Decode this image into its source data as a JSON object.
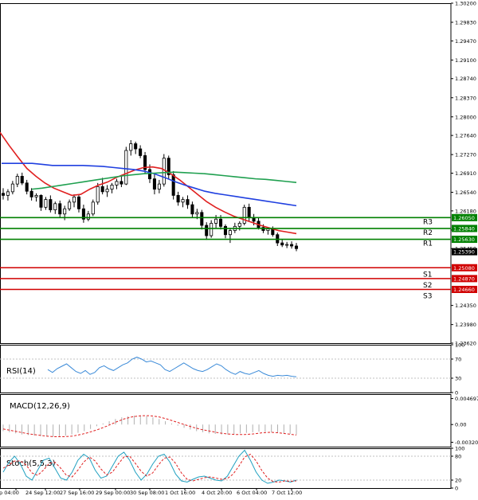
{
  "chart_data": {
    "type": "candlestick",
    "instrument_timeframe": "",
    "x_axis": {
      "tick_labels": [
        "ep 04:00",
        "24 Sep 12:00",
        "27 Sep 16:00",
        "29 Sep 00:00",
        "30 Sep 08:00",
        "1 Oct 16:00",
        "4 Oct 20:00",
        "6 Oct 04:00",
        "7 Oct 12:00"
      ]
    },
    "main_panel": {
      "y_ticks": [
        "1.30200",
        "1.29830",
        "1.29470",
        "1.29100",
        "1.28740",
        "1.28370",
        "1.28000",
        "1.27640",
        "1.27270",
        "1.26910",
        "1.26540",
        "1.26180",
        "1.25810",
        "1.25450",
        "1.24350",
        "1.23980",
        "1.23620"
      ],
      "ylim": [
        1.2362,
        1.302
      ],
      "current_price": "1.25390",
      "levels": [
        {
          "name": "R3",
          "value": 1.2605,
          "label": "1.26050",
          "color": "#008000"
        },
        {
          "name": "R2",
          "value": 1.2584,
          "label": "1.25840",
          "color": "#008000"
        },
        {
          "name": "R1",
          "value": 1.2563,
          "label": "1.25630",
          "color": "#008000"
        },
        {
          "name": "S1",
          "value": 1.2508,
          "label": "1.25080",
          "color": "#d00000"
        },
        {
          "name": "S2",
          "value": 1.2487,
          "label": "1.24870",
          "color": "#d00000"
        },
        {
          "name": "S3",
          "value": 1.2466,
          "label": "1.24660",
          "color": "#d00000"
        }
      ],
      "candles": [
        [
          1.2652,
          1.2662,
          1.264,
          1.2648
        ],
        [
          1.2648,
          1.266,
          1.2638,
          1.2655
        ],
        [
          1.2655,
          1.2676,
          1.265,
          1.267
        ],
        [
          1.267,
          1.269,
          1.2664,
          1.2685
        ],
        [
          1.2685,
          1.2692,
          1.2668,
          1.2672
        ],
        [
          1.2672,
          1.2678,
          1.265,
          1.2656
        ],
        [
          1.2656,
          1.2662,
          1.2638,
          1.2645
        ],
        [
          1.2645,
          1.2652,
          1.2636,
          1.2648
        ],
        [
          1.2648,
          1.265,
          1.2618,
          1.2625
        ],
        [
          1.2625,
          1.2645,
          1.262,
          1.264
        ],
        [
          1.264,
          1.2648,
          1.2615,
          1.262
        ],
        [
          1.262,
          1.2636,
          1.2612,
          1.2632
        ],
        [
          1.2632,
          1.2638,
          1.2605,
          1.2612
        ],
        [
          1.2612,
          1.2628,
          1.26,
          1.2622
        ],
        [
          1.2622,
          1.264,
          1.2618,
          1.2635
        ],
        [
          1.2635,
          1.265,
          1.2625,
          1.2645
        ],
        [
          1.2645,
          1.265,
          1.2615,
          1.2622
        ],
        [
          1.2622,
          1.263,
          1.2595,
          1.2602
        ],
        [
          1.2602,
          1.2618,
          1.2598,
          1.2612
        ],
        [
          1.2612,
          1.264,
          1.2608,
          1.2635
        ],
        [
          1.2635,
          1.2672,
          1.263,
          1.2665
        ],
        [
          1.2665,
          1.2682,
          1.265,
          1.2655
        ],
        [
          1.2655,
          1.2668,
          1.2645,
          1.266
        ],
        [
          1.266,
          1.2672,
          1.2652,
          1.2668
        ],
        [
          1.2668,
          1.268,
          1.266,
          1.2675
        ],
        [
          1.2675,
          1.2688,
          1.2664,
          1.267
        ],
        [
          1.267,
          1.2742,
          1.2668,
          1.2735
        ],
        [
          1.2735,
          1.2755,
          1.2725,
          1.2748
        ],
        [
          1.2748,
          1.2752,
          1.2728,
          1.2738
        ],
        [
          1.2738,
          1.2745,
          1.272,
          1.2725
        ],
        [
          1.2725,
          1.2732,
          1.269,
          1.2698
        ],
        [
          1.2698,
          1.2708,
          1.2672,
          1.268
        ],
        [
          1.268,
          1.269,
          1.265,
          1.266
        ],
        [
          1.266,
          1.2678,
          1.2652,
          1.267
        ],
        [
          1.267,
          1.2728,
          1.2665,
          1.272
        ],
        [
          1.272,
          1.2725,
          1.268,
          1.2688
        ],
        [
          1.2688,
          1.2695,
          1.264,
          1.2648
        ],
        [
          1.2648,
          1.2655,
          1.2628,
          1.2635
        ],
        [
          1.2635,
          1.2645,
          1.2625,
          1.264
        ],
        [
          1.264,
          1.2648,
          1.2622,
          1.263
        ],
        [
          1.263,
          1.2636,
          1.2605,
          1.2612
        ],
        [
          1.2612,
          1.2622,
          1.2602,
          1.2615
        ],
        [
          1.2615,
          1.262,
          1.2582,
          1.259
        ],
        [
          1.259,
          1.2596,
          1.2562,
          1.257
        ],
        [
          1.257,
          1.26,
          1.2566,
          1.2594
        ],
        [
          1.2594,
          1.261,
          1.2585,
          1.2602
        ],
        [
          1.2602,
          1.261,
          1.2582,
          1.2588
        ],
        [
          1.2588,
          1.2592,
          1.2565,
          1.2572
        ],
        [
          1.2572,
          1.2585,
          1.2556,
          1.258
        ],
        [
          1.258,
          1.2595,
          1.2575,
          1.2588
        ],
        [
          1.2588,
          1.2598,
          1.258,
          1.2594
        ],
        [
          1.2594,
          1.263,
          1.259,
          1.2625
        ],
        [
          1.2625,
          1.2632,
          1.2598,
          1.2605
        ],
        [
          1.2605,
          1.2612,
          1.259,
          1.2598
        ],
        [
          1.2598,
          1.2604,
          1.2582,
          1.2586
        ],
        [
          1.2586,
          1.2592,
          1.2575,
          1.258
        ],
        [
          1.258,
          1.2586,
          1.2572,
          1.2583
        ],
        [
          1.2583,
          1.2588,
          1.2568,
          1.2572
        ],
        [
          1.2572,
          1.2576,
          1.255,
          1.2556
        ],
        [
          1.2556,
          1.2562,
          1.2548,
          1.2552
        ],
        [
          1.2552,
          1.2558,
          1.2546,
          1.2553
        ],
        [
          1.2553,
          1.2559,
          1.2545,
          1.255
        ],
        [
          1.255,
          1.2556,
          1.254,
          1.2545
        ]
      ],
      "ma_series": [
        {
          "color": "#e02020",
          "values": [
            1.277,
            1.2745,
            1.2722,
            1.27,
            1.2685,
            1.2672,
            1.2662,
            1.2655,
            1.2648,
            1.265,
            1.266,
            1.2668,
            1.2674,
            1.2683,
            1.269,
            1.2697,
            1.2702,
            1.2703,
            1.27,
            1.269,
            1.2678,
            1.2664,
            1.265,
            1.2636,
            1.2625,
            1.2616,
            1.2608,
            1.2602,
            1.2596,
            1.259,
            1.2585,
            1.258,
            1.2577,
            1.2574
          ]
        },
        {
          "color": "#2040e0",
          "values": [
            1.271,
            1.271,
            1.271,
            1.271,
            1.2708,
            1.2706,
            1.2706,
            1.2706,
            1.2706,
            1.2705,
            1.2704,
            1.2702,
            1.27,
            1.2698,
            1.2695,
            1.269,
            1.2683,
            1.2675,
            1.2668,
            1.2662,
            1.2656,
            1.2652,
            1.2649,
            1.2646,
            1.2643,
            1.264,
            1.2637,
            1.2634,
            1.2631,
            1.2628
          ]
        },
        {
          "color": "#20a050",
          "values": [
            1.266,
            1.2662,
            1.2665,
            1.2668,
            1.2671,
            1.2674,
            1.2677,
            1.268,
            1.2683,
            1.2686,
            1.2688,
            1.269,
            1.2691,
            1.2692,
            1.2693,
            1.2692,
            1.2691,
            1.269,
            1.2688,
            1.2686,
            1.2684,
            1.2682,
            1.268,
            1.2679,
            1.2677,
            1.2675,
            1.2673
          ]
        }
      ]
    },
    "rsi_panel": {
      "label": "RSI(14)",
      "y_ticks": [
        "100",
        "70",
        "30",
        "0"
      ],
      "ylim": [
        0,
        100
      ],
      "values": [
        48,
        42,
        50,
        55,
        60,
        52,
        44,
        40,
        46,
        38,
        42,
        52,
        56,
        50,
        46,
        52,
        58,
        62,
        70,
        74,
        70,
        64,
        66,
        62,
        58,
        48,
        44,
        50,
        56,
        62,
        56,
        50,
        46,
        44,
        48,
        54,
        60,
        56,
        48,
        42,
        38,
        44,
        40,
        38,
        42,
        46,
        40,
        36,
        34,
        36,
        35,
        36,
        34,
        33
      ]
    },
    "macd_panel": {
      "label": "MACD(12,26,9)",
      "y_ticks": [
        "0.004697",
        "0.00",
        "-0.003206"
      ],
      "ylim": [
        -0.004,
        0.0055
      ],
      "histogram": [
        -0.0012,
        -0.0014,
        -0.0016,
        -0.0018,
        -0.0019,
        -0.002,
        -0.0021,
        -0.0022,
        -0.0022,
        -0.0021,
        -0.002,
        -0.0018,
        -0.0015,
        -0.0012,
        -0.0008,
        -0.0003,
        0.0002,
        0.0006,
        0.001,
        0.0013,
        0.0015,
        0.0016,
        0.0016,
        0.0015,
        0.0013,
        0.001,
        0.0006,
        0.0002,
        -0.0002,
        -0.0006,
        -0.0009,
        -0.0012,
        -0.0014,
        -0.0016,
        -0.0017,
        -0.0018,
        -0.0018,
        -0.0017,
        -0.0016,
        -0.0015,
        -0.0014,
        -0.0013,
        -0.0013,
        -0.0014,
        -0.0015,
        -0.0016,
        -0.0017,
        -0.0018
      ],
      "signal": [
        -0.0008,
        -0.0011,
        -0.0014,
        -0.0017,
        -0.0019,
        -0.0021,
        -0.0022,
        -0.0022,
        -0.0021,
        -0.0018,
        -0.0014,
        -0.0009,
        -0.0003,
        0.0004,
        0.001,
        0.0014,
        0.0016,
        0.0016,
        0.0014,
        0.001,
        0.0005,
        0.0,
        -0.0005,
        -0.0009,
        -0.0012,
        -0.0015,
        -0.0017,
        -0.0018,
        -0.0018,
        -0.0017,
        -0.0015,
        -0.0014,
        -0.0015,
        -0.0017,
        -0.0019
      ]
    },
    "stoch_panel": {
      "label": "Stoch(5,5,3)",
      "y_ticks": [
        "100",
        "80",
        "20",
        "0"
      ],
      "ylim": [
        0,
        100
      ],
      "k": [
        40,
        65,
        80,
        60,
        30,
        20,
        45,
        70,
        75,
        50,
        25,
        20,
        40,
        70,
        85,
        75,
        45,
        25,
        30,
        55,
        80,
        90,
        70,
        40,
        20,
        35,
        60,
        80,
        85,
        65,
        35,
        18,
        15,
        22,
        28,
        30,
        25,
        20,
        18,
        30,
        55,
        80,
        95,
        70,
        40,
        20,
        12,
        15,
        20,
        18,
        15,
        20
      ],
      "d": [
        50,
        58,
        68,
        68,
        58,
        38,
        32,
        45,
        62,
        65,
        50,
        32,
        28,
        45,
        65,
        78,
        68,
        48,
        33,
        40,
        60,
        78,
        80,
        62,
        42,
        30,
        38,
        58,
        75,
        78,
        62,
        38,
        22,
        18,
        22,
        26,
        28,
        25,
        22,
        24,
        35,
        55,
        78,
        85,
        68,
        44,
        25,
        16,
        15,
        18,
        17,
        18
      ]
    }
  }
}
